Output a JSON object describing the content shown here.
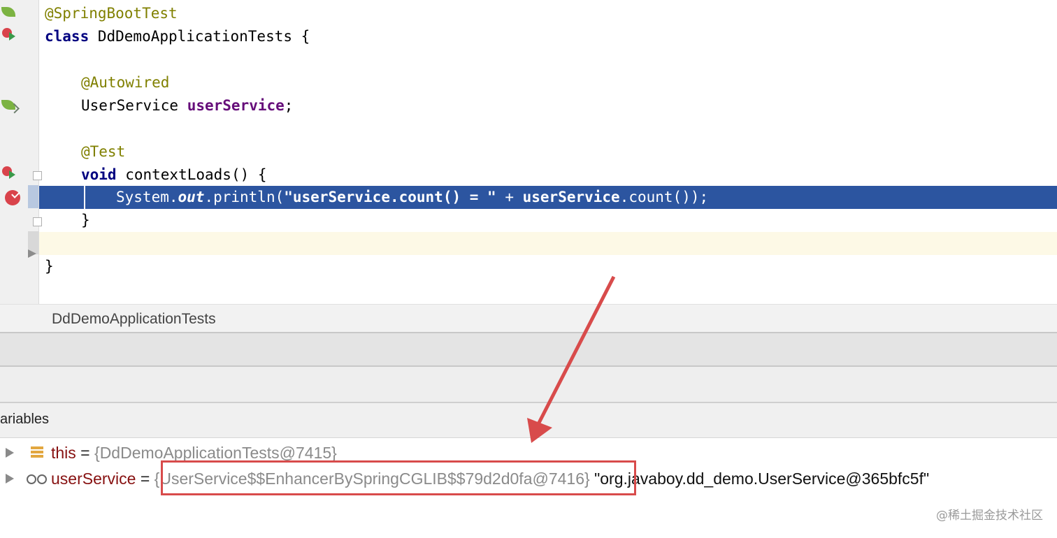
{
  "editor": {
    "lines": {
      "l1": {
        "anno": "@SpringBootTest"
      },
      "l2": {
        "kw": "class",
        "rest": " DdDemoApplicationTests {"
      },
      "l4": {
        "anno": "@Autowired"
      },
      "l5": {
        "type": "UserService ",
        "field": "userService",
        "end": ";"
      },
      "l7": {
        "anno": "@Test"
      },
      "l8": {
        "kw": "void",
        "rest": " contextLoads() {"
      },
      "l9": {
        "p1": "System.",
        "p2": "out",
        "p3": ".println(",
        "p4": "\"userService.count() = \"",
        "p5": " + ",
        "p6": "userService",
        "p7": ".count());"
      },
      "l10": {
        "text": "}"
      },
      "l12": {
        "text": "}"
      }
    }
  },
  "breadcrumb": {
    "label": "DdDemoApplicationTests"
  },
  "variables_panel": {
    "title": "ariables",
    "rows": [
      {
        "name": "this",
        "eq": " = ",
        "value": "{DdDemoApplicationTests@7415}"
      },
      {
        "name": "userService",
        "eq": " = ",
        "value": "{UserService$$EnhancerBySpringCGLIB$$79d2d0fa@7416}",
        "string": " \"org.javaboy.dd_demo.UserService@365bfc5f\""
      }
    ]
  },
  "annotation": {
    "highlight_color": "#d84b4b"
  },
  "watermark": "@稀土掘金技术社区",
  "colors": {
    "current_line": "#2c55a0",
    "keyword": "#000080",
    "annotation": "#808000",
    "field": "#660e7a",
    "variable_name": "#871111",
    "caret_line": "#fdf9e6"
  }
}
